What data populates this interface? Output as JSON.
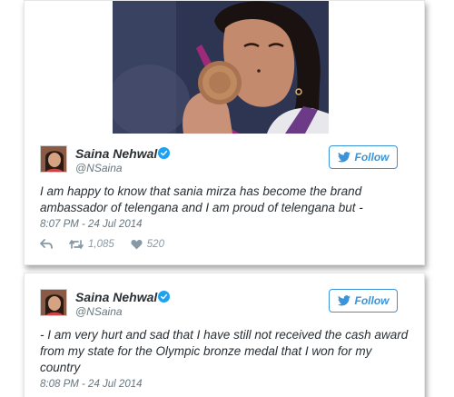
{
  "tweets": [
    {
      "author_name": "Saina Nehwal",
      "author_handle": "@NSaina",
      "follow_label": "Follow",
      "text": "I am happy to know that sania mirza has become the brand ambassador of telengana and I am proud of telengana but -",
      "timestamp": "8:07 PM - 24 Jul 2014",
      "retweets": "1,085",
      "likes": "520"
    },
    {
      "author_name": "Saina Nehwal",
      "author_handle": "@NSaina",
      "follow_label": "Follow",
      "text": "- I am very hurt and sad that I have still not received the cash award from my state for the Olympic bronze medal that I won for my country",
      "timestamp": "8:08 PM - 24 Jul 2014"
    }
  ],
  "icons": {
    "verified": "verified-badge-icon",
    "follow": "twitter-bird-icon",
    "reply": "reply-icon",
    "retweet": "retweet-icon",
    "like": "heart-icon"
  },
  "colors": {
    "twitter_blue": "#3b94d9",
    "verified_blue": "#1da1f2",
    "text": "#292f33",
    "muted": "#66757f"
  }
}
